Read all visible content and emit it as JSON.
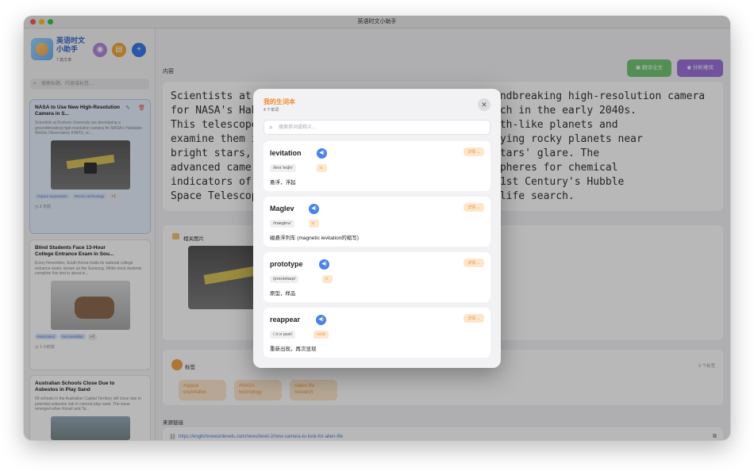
{
  "window": {
    "title": "英语时文小助手"
  },
  "app": {
    "title": "英语时文小助手",
    "subtitle": "7 篇文章"
  },
  "search": {
    "placeholder": "搜索标题、内容或标签..."
  },
  "articles": [
    {
      "title": "NASA to Use New High-Resolution Camera in S...",
      "summary": "Scientists at Durham University are developing a groundbreaking high-resolution camera for NASA's Habitable Worlds Observatory (HWO), sc...",
      "tags": [
        "#space exploration",
        "#NASA technology"
      ],
      "more": "+1",
      "time": "3 天前"
    },
    {
      "title": "Blind Students Face 13-Hour College Entrance Exam in Sou...",
      "summary": "Every November, South Korea holds its national college entrance exam, known as the Suneung. While most students complete this test in about ei...",
      "tags": [
        "#education",
        "#accessibility"
      ],
      "more": "+1",
      "time": "1 小时前"
    },
    {
      "title": "Australian Schools Close Due to Asbestos in Play Sand",
      "summary": "69 schools in the Australian Capital Territory will close due to potential asbestos risk in colored play sand. The issue emerged when Kmart and Ta..."
    }
  ],
  "main": {
    "content_label": "内容",
    "translate_label": "翻译全文",
    "analyze_label": "分析难词",
    "content_text": "Scientists at Durham University are developing a groundbreaking high-resolution camera\nfor NASA's Hab                             ed to launch in the early 2040s.\nThis telescope                            to find Earth-like planets and\nexamine them i                            nge of studying rocky planets near\nbright stars,                             block the stars' glare. The\nadvanced camer                            their atmospheres for chemical\nindicators of                             it as the 21st Century's Hubble\nSpace Telescop                            yond alien life search.",
    "images_label": "相关图片",
    "tags_label": "标签",
    "tags_count": "3 个标签",
    "tags": [
      "#space exploration",
      "#NASA technology",
      "#alien life research"
    ],
    "source_label": "来源链接",
    "source_url": "https://englishnewsinlevels.com/news/level-2/new-camera-to-look-for-alien-life"
  },
  "modal": {
    "title": "我的生词本",
    "count": "4 个单词",
    "search_placeholder": "搜索单词或释义...",
    "detail_label": "详情",
    "words": [
      {
        "word": "levitation",
        "phonetic": "/levɪˈteɪʃn/",
        "pos": "n.",
        "meaning": "悬浮，浮起"
      },
      {
        "word": "Maglev",
        "phonetic": "/mæglev/",
        "pos": "n.",
        "meaning": "磁悬浮列车 (magnetic levitation的缩写)"
      },
      {
        "word": "prototype",
        "phonetic": "/prəʊtətaɪp/",
        "pos": "n.",
        "meaning": "原型，样品"
      },
      {
        "word": "reappear",
        "phonetic": "/ˌriːəˈpɪər/",
        "pos": "verb",
        "meaning": "重新出现，再次显现"
      }
    ]
  },
  "colors": {
    "accent": "#f08b2b",
    "primary": "#4a82e8",
    "translate": "#74c777",
    "analyze": "#9b74d9"
  }
}
